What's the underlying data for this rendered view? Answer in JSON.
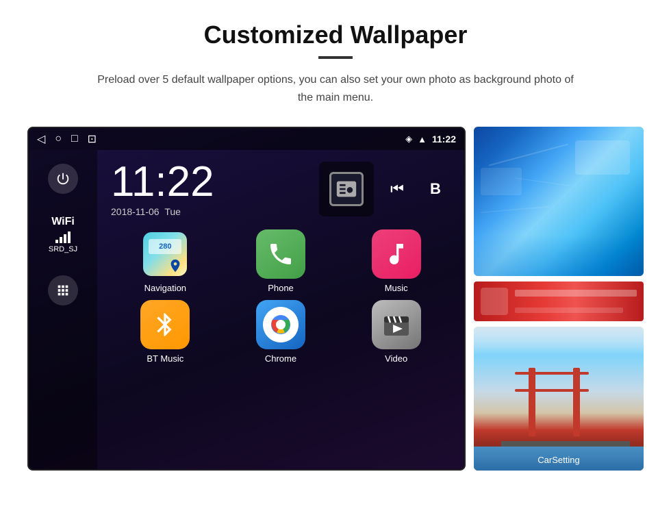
{
  "page": {
    "title": "Customized Wallpaper",
    "subtitle": "Preload over 5 default wallpaper options, you can also set your own photo as background photo of the main menu."
  },
  "device": {
    "time": "11:22",
    "date": "2018-11-06",
    "day": "Tue",
    "wifi_label": "WiFi",
    "wifi_ssid": "SRD_SJ"
  },
  "apps": [
    {
      "name": "Navigation",
      "type": "navigation"
    },
    {
      "name": "Phone",
      "type": "phone"
    },
    {
      "name": "Music",
      "type": "music"
    },
    {
      "name": "BT Music",
      "type": "bluetooth"
    },
    {
      "name": "Chrome",
      "type": "chrome"
    },
    {
      "name": "Video",
      "type": "video"
    }
  ],
  "wallpapers": {
    "top_label": "",
    "bottom_label": "CarSetting"
  }
}
